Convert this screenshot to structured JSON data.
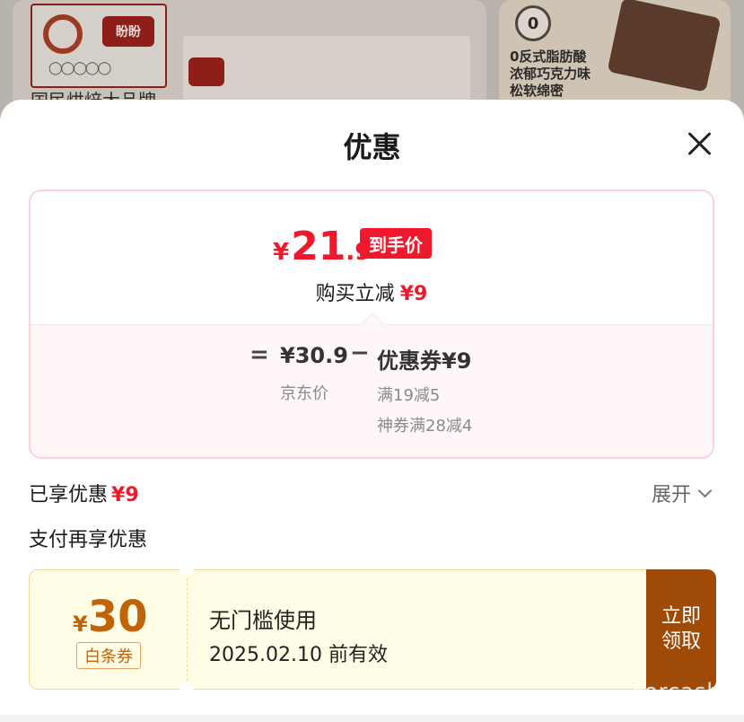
{
  "background": {
    "brand_logo_text": "盼盼",
    "card1_title": "国民烘焙大品牌",
    "card2_badge": "0",
    "card2_lines": [
      "0反式脂肪酸",
      "浓郁巧克力味",
      "松软绵密"
    ]
  },
  "sheet": {
    "title": "优惠",
    "final_price": {
      "currency": "¥",
      "integer": "21",
      "decimal": ".9",
      "badge": "到手价"
    },
    "saved": {
      "label": "购买立减",
      "amount": "¥9"
    },
    "calc": {
      "equals": "=",
      "original_price": "¥30.9",
      "original_label": "京东价",
      "minus": "−",
      "coupon": "优惠券¥9",
      "coupon_rules": [
        "满19减5",
        "神券满28减4"
      ]
    },
    "enjoyed": {
      "label": "已享优惠",
      "amount": "¥9",
      "expand_label": "展开"
    },
    "pay_more_label": "支付再享优惠",
    "ticket": {
      "currency": "¥",
      "amount": "30",
      "tag": "白条券",
      "title": "无门槛使用",
      "validity": "2025.02.10 前有效",
      "button_line1": "立即",
      "button_line2": "领取"
    }
  },
  "watermark": "Forcash",
  "colors": {
    "accent_red": "#f0182c",
    "coupon_brown": "#a04a08",
    "coupon_bg": "#fffde5"
  }
}
